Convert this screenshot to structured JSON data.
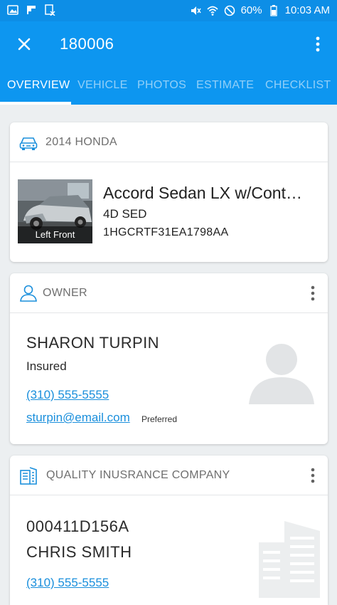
{
  "status_bar": {
    "battery": "60%",
    "time": "10:03 AM",
    "icons": [
      "gallery-icon",
      "flipboard-icon",
      "document-block-icon",
      "mute-icon",
      "wifi-icon",
      "no-disturb-icon",
      "battery-icon"
    ]
  },
  "app_bar": {
    "title": "180006",
    "close_icon": "close-icon",
    "more_icon": "more-vert-icon",
    "color": "#0d96f0"
  },
  "tabs": [
    {
      "label": "OVERVIEW",
      "active": true
    },
    {
      "label": "VEHICLE",
      "active": false
    },
    {
      "label": "PHOTOS",
      "active": false
    },
    {
      "label": "ESTIMATE",
      "active": false
    },
    {
      "label": "CHECKLIST",
      "active": false
    }
  ],
  "vehicle": {
    "header": "2014 HONDA",
    "icon": "car-icon",
    "photo_caption": "Left Front",
    "model": "Accord Sedan LX w/Cont…",
    "body": "4D SED",
    "vin": "1HGCRTF31EA1798AA"
  },
  "owner": {
    "header": "OWNER",
    "icon": "person-icon",
    "name": "SHARON TURPIN",
    "role": "Insured",
    "phone": "(310) 555-5555",
    "email": "sturpin@email.com",
    "email_tag": "Preferred"
  },
  "insurance": {
    "header": "QUALITY INUSRANCE COMPANY",
    "icon": "building-icon",
    "policy": "000411D156A",
    "agent": "CHRIS SMITH",
    "phone": "(310) 555-5555"
  },
  "colors": {
    "accent": "#0d96f0",
    "link": "#1a8fdc"
  }
}
